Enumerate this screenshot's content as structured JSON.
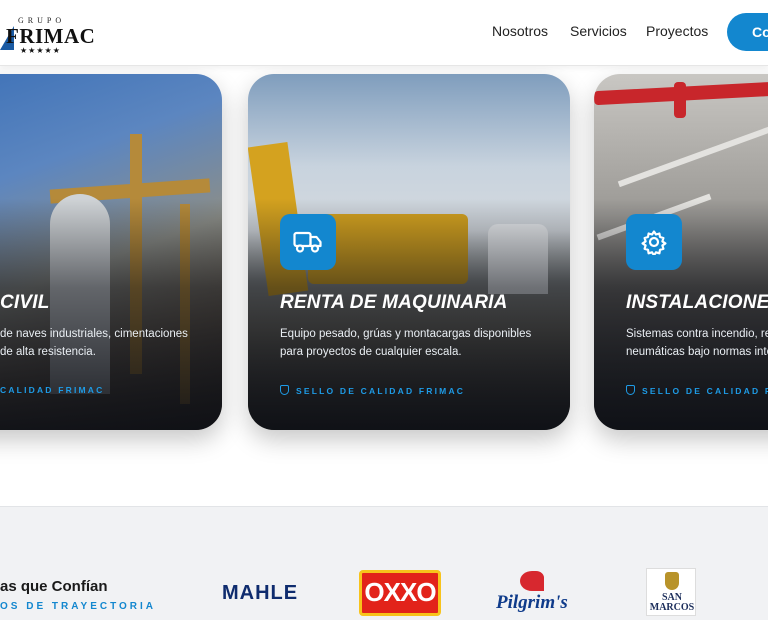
{
  "header": {
    "logo": {
      "top": "GRUPO",
      "name": "FRIMAC",
      "stars": "★★★★★"
    },
    "nav": [
      "Nosotros",
      "Servicios",
      "Proyectos"
    ],
    "cta_label": "Co"
  },
  "cards": [
    {
      "title": "CIVIL",
      "desc": [
        "de naves industriales, cimentaciones",
        "de alta resistencia."
      ],
      "seal": "CALIDAD FRIMAC",
      "icon": "building-icon"
    },
    {
      "title": "RENTA DE MAQUINARIA",
      "desc": [
        "Equipo pesado, grúas y montacargas disponibles",
        "para proyectos de cualquier escala."
      ],
      "seal": "SELLO DE CALIDAD FRIMAC",
      "icon": "truck-icon"
    },
    {
      "title": "INSTALACIONES",
      "desc": [
        "Sistemas contra incendio, red",
        "neumáticas bajo normas inte"
      ],
      "seal": "SELLO DE CALIDAD FRIM",
      "icon": "gear-icon"
    }
  ],
  "clients": {
    "title": "as que Confían",
    "subtitle": "OS DE TRAYECTORIA",
    "logos": [
      "MAHLE",
      "OXXO",
      "Pilgrim's",
      "SAN MARCOS"
    ]
  },
  "colors": {
    "accent": "#1387cf",
    "seal": "#1e9be6"
  }
}
